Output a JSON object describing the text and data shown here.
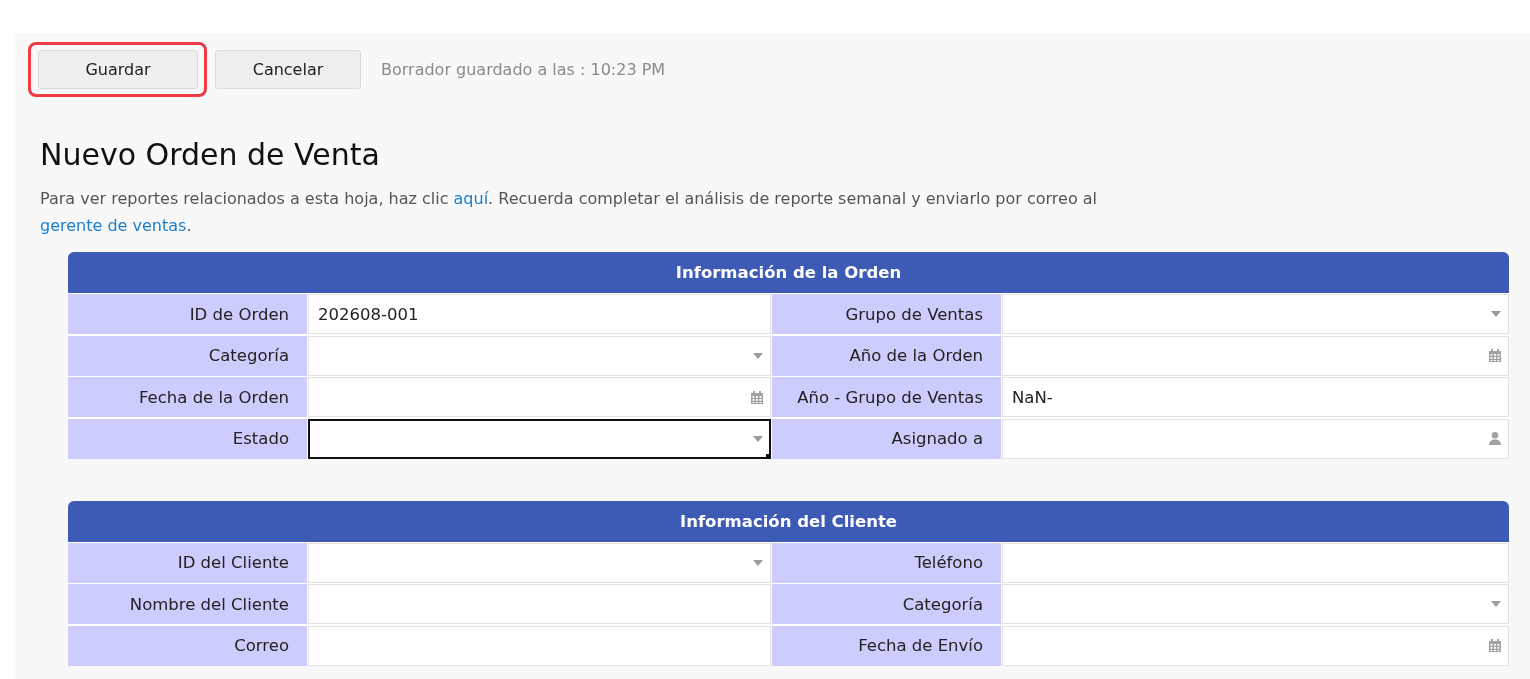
{
  "toolbar": {
    "buttons": [
      {
        "label": "Guardar",
        "highlighted": true
      },
      {
        "label": "Cancelar",
        "highlighted": false
      }
    ],
    "status": "Borrador guardado a las : 10:23 PM"
  },
  "heading": {
    "title": "Nuevo Orden de Venta",
    "intro": [
      {
        "kind": "text",
        "text": "Para ver reportes relacionados a esta hoja, haz clic "
      },
      {
        "kind": "link",
        "text": "aquí"
      },
      {
        "kind": "text",
        "text": ". Recuerda completar el análisis de reporte semanal y enviarlo por correo al "
      },
      {
        "kind": "link",
        "text": "gerente de ventas"
      },
      {
        "kind": "text",
        "text": "."
      }
    ]
  },
  "sections": [
    {
      "title": "Información de la Orden",
      "rows": [
        {
          "left": {
            "label": "ID de Orden",
            "kind": "text",
            "value": "202608-001",
            "selected": false
          },
          "right": {
            "label": "Grupo de Ventas",
            "kind": "dropdown",
            "selected": false
          }
        },
        {
          "left": {
            "label": "Categoría",
            "kind": "dropdown",
            "selected": false
          },
          "right": {
            "label": "Año de la Orden",
            "kind": "date",
            "selected": false
          }
        },
        {
          "left": {
            "label": "Fecha de la Orden",
            "kind": "date",
            "selected": false
          },
          "right": {
            "label": "Año - Grupo de Ventas",
            "kind": "text",
            "value": "NaN-",
            "selected": false
          }
        },
        {
          "left": {
            "label": "Estado",
            "kind": "dropdown",
            "selected": true
          },
          "right": {
            "label": "Asignado a",
            "kind": "person",
            "selected": false
          }
        }
      ]
    },
    {
      "title": "Información del Cliente",
      "rows": [
        {
          "left": {
            "label": "ID del Cliente",
            "kind": "dropdown",
            "selected": false
          },
          "right": {
            "label": "Teléfono",
            "kind": "text",
            "selected": false
          }
        },
        {
          "left": {
            "label": "Nombre del Cliente",
            "kind": "text",
            "selected": false
          },
          "right": {
            "label": "Categoría",
            "kind": "dropdown",
            "selected": false
          }
        },
        {
          "left": {
            "label": "Correo",
            "kind": "text",
            "selected": false
          },
          "right": {
            "label": "Fecha de Envío",
            "kind": "date",
            "selected": false
          }
        }
      ]
    }
  ]
}
